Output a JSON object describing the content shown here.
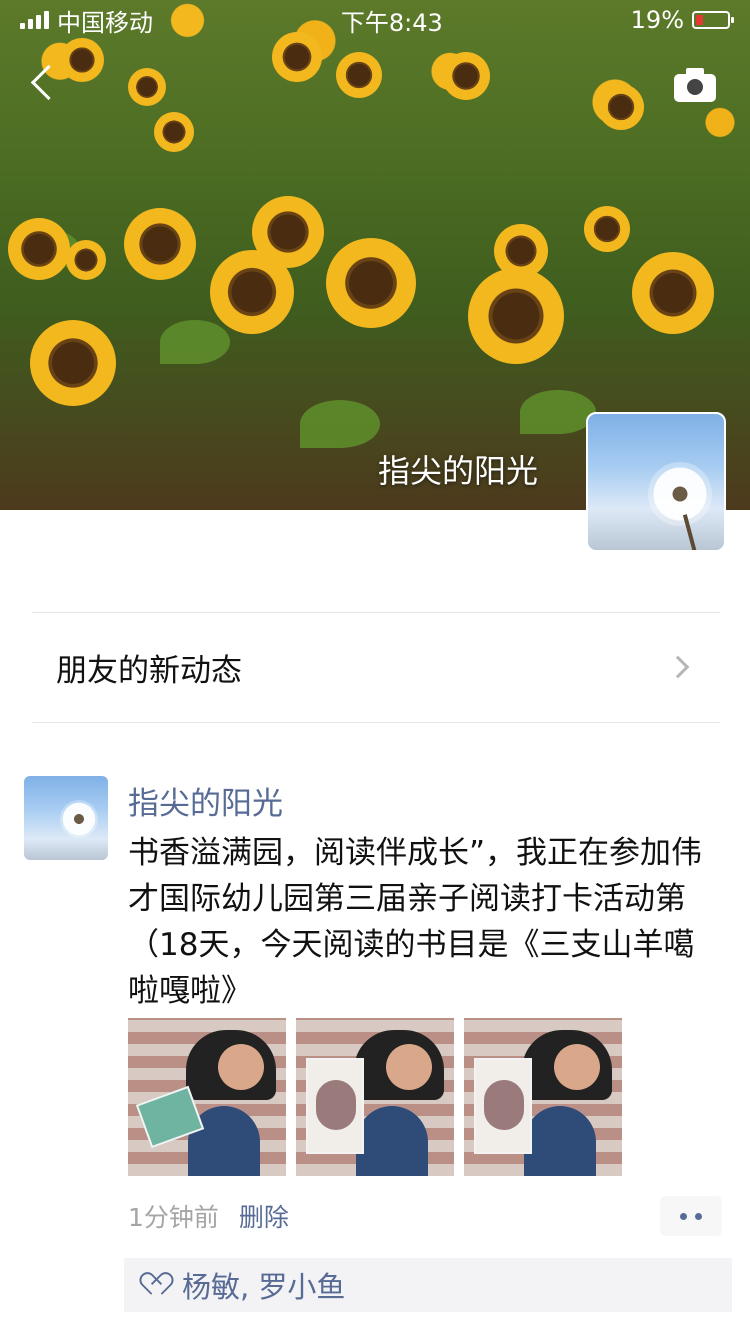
{
  "status_bar": {
    "carrier": "中国移动",
    "time": "下午8:43",
    "battery": "19%"
  },
  "cover": {
    "name": "指尖的阳光"
  },
  "friends_updates": {
    "label": "朋友的新动态"
  },
  "post": {
    "author": "指尖的阳光",
    "text": "书香溢满园，阅读伴成长”，我正在参加伟才国际幼儿园第三届亲子阅读打卡活动第（18天，今天阅读的书目是《三支山羊噶啦嘎啦》",
    "time": "1分钟前",
    "delete_label": "删除",
    "likes": "杨敏, 罗小鱼"
  },
  "icons": {
    "back": "back-arrow-icon",
    "camera": "camera-icon",
    "chevron": "chevron-right-icon",
    "heart": "heart-icon",
    "more": "more-dots-icon"
  },
  "colors": {
    "link": "#576b95",
    "muted": "#a5a5a5"
  }
}
